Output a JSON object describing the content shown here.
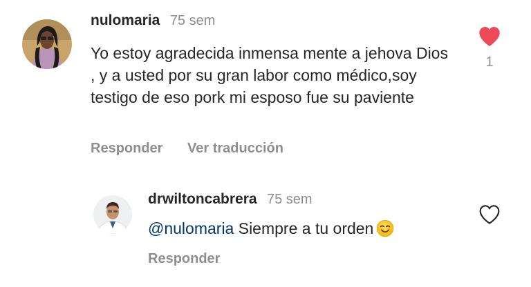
{
  "comments": [
    {
      "username": "nulomaria",
      "time": "75 sem",
      "text": "Yo estoy agradecida inmensa mente a jehova Dios , y a usted por su gran labor como médico,soy testigo de eso pork mi esposo fue su paviente",
      "actions": {
        "reply": "Responder",
        "translate": "Ver traducción"
      },
      "liked": true,
      "like_count": "1",
      "avatar_icon": "user-photo-icon"
    }
  ],
  "reply": {
    "username": "drwiltoncabrera",
    "time": "75 sem",
    "mention": "@nulomaria",
    "text": "Siempre a tu orden",
    "emoji": "smiling-face-emoji",
    "actions": {
      "reply": "Responder"
    },
    "liked": false
  },
  "colors": {
    "text": "#262626",
    "muted": "#8e8e8e",
    "mention": "#00376b",
    "like_active": "#ed4956",
    "background": "#ffffff"
  }
}
